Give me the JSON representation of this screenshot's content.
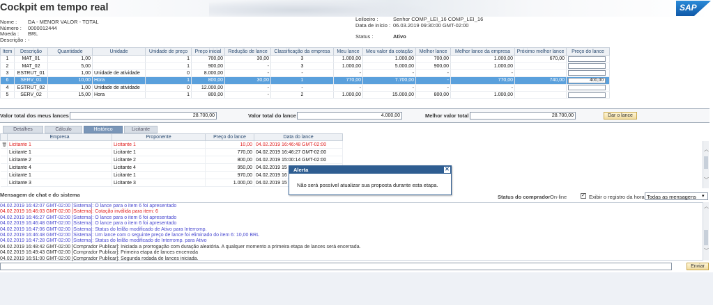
{
  "header": {
    "title": "Cockpit em tempo real",
    "sap": "SAP"
  },
  "info_left": [
    {
      "label": "Nome :",
      "value": "DA - MENOR VALOR - TOTAL"
    },
    {
      "label": "Número :",
      "value": "0000012444"
    },
    {
      "label": "Moeda :",
      "value": "BRL"
    },
    {
      "label": "Descrição :",
      "value": "-"
    }
  ],
  "info_right": [
    {
      "label": "Leiloeiro :",
      "value": "Senhor COMP_LEI_16 COMP_LEI_16"
    },
    {
      "label": "Data de início :",
      "value": "06.03.2019 09:30:00 GMT-02:00"
    },
    {
      "label": "Status :",
      "value": "Ativo"
    }
  ],
  "items_table": {
    "headers": [
      "Item",
      "Descrição",
      "Quantidade",
      "Unidade",
      "Unidade de preço",
      "Preço inicial",
      "Redução de lance",
      "Classificação da empresa",
      "Meu lance",
      "Meu valor da cotação",
      "Melhor lance",
      "Melhor lance da empresa",
      "Próximo melhor lance",
      "Preço do lance"
    ],
    "rows": [
      [
        "1",
        "MAT_01",
        "1,00",
        "",
        "1",
        "700,00",
        "30,00",
        "3",
        "1.000,00",
        "1.000,00",
        "700,00",
        "1.000,00",
        "670,00",
        ""
      ],
      [
        "2",
        "MAT_02",
        "5,00",
        "",
        "1",
        "900,00",
        "-",
        "3",
        "1.000,00",
        "5.000,00",
        "900,00",
        "1.000,00",
        "",
        ""
      ],
      [
        "3",
        "ESTRUT_01",
        "1,00",
        "Unidade de atividade",
        "0",
        "8.000,00",
        "-",
        "-",
        "-",
        "-",
        "-",
        "-",
        "",
        ""
      ],
      [
        "6",
        "SERV_01",
        "10,00",
        "Hora",
        "1",
        "800,00",
        "30,00",
        "1",
        "770,00",
        "7.700,00",
        "-",
        "770,00",
        "740,00",
        "400,00"
      ],
      [
        "4",
        "ESTRUT_02",
        "1,00",
        "Unidade de atividade",
        "0",
        "12.000,00",
        "-",
        "-",
        "-",
        "-",
        "-",
        "-",
        "",
        ""
      ],
      [
        "5",
        "SERV_02",
        "15,00",
        "Hora",
        "1",
        "800,00",
        "-",
        "2",
        "1.000,00",
        "15.000,00",
        "800,00",
        "1.000,00",
        "",
        ""
      ]
    ],
    "selected_index": 3
  },
  "totals": {
    "my_bids_label": "Valor total dos meus lances",
    "my_bids_value": "28.700,00",
    "bid_total_label": "Valor total do lance",
    "bid_total_value": "4.000,00",
    "best_total_label": "Melhor valor total",
    "best_total_value": "28.700,00",
    "bid_button": "Dar o lance"
  },
  "tabs": [
    "Detalhes",
    "Cálculo",
    "Histórico",
    "Licitante"
  ],
  "active_tab": "Histórico",
  "history": {
    "headers": [
      "Empresa",
      "Proponente",
      "Preço do lance",
      "Data do lance"
    ],
    "rows": [
      [
        "Licitante 1",
        "Licitante 1",
        "10,00",
        "04.02.2019 16:46:48 GMT-02:00"
      ],
      [
        "Licitante 1",
        "Licitante 1",
        "770,00",
        "04.02.2019 16:46:27 GMT-02:00"
      ],
      [
        "Licitante 2",
        "Licitante 2",
        "800,00",
        "04.02.2019 15:00:14 GMT-02:00"
      ],
      [
        "Licitante 4",
        "Licitante 4",
        "950,00",
        "04.02.2019 15"
      ],
      [
        "Licitante 1",
        "Licitante 1",
        "970,00",
        "04.02.2019 16"
      ],
      [
        "Licitante 3",
        "Licitante 3",
        "1.000,00",
        "04.02.2019 15"
      ]
    ]
  },
  "alert": {
    "title": "Alerta",
    "message": "Não será possível atualizar sua proposta durante esta etapa."
  },
  "chat": {
    "title": "Mensagem de chat e do sistema",
    "buyer_status_label": "Status do comprador",
    "buyer_status_value": "On-line",
    "show_time_label": "Exibir o registro da hora",
    "filter_value": "Todas as mensagens",
    "send_button": "Enviar",
    "messages": [
      {
        "text": "04.02.2019 16:42:07 GMT-02:00 [Sistema]: O lance para o item 6 foi apresentado",
        "color": "#4a4ad0"
      },
      {
        "text": "04.02.2019 16:46:03 GMT-02:00 [Sistema]: Cotação inválida para item: 6",
        "color": "#e02020"
      },
      {
        "text": "04.02.2019 16:46:27 GMT-02:00 [Sistema]: O lance para o item 6 foi apresentado",
        "color": "#4a4ad0"
      },
      {
        "text": "04.02.2019 16:46:48 GMT-02:00 [Sistema]: O lance para o item 6 foi apresentado",
        "color": "#4a4ad0"
      },
      {
        "text": "04.02.2019 16:47:06 GMT-02:00 [Sistema]: Status do leilão modificado de Ativo para Interromp.",
        "color": "#4a4ad0"
      },
      {
        "text": "04.02.2019 16:46:48 GMT-02:00 [Sistema]: Um lance com o seguinte preço de lance foi eliminado do item 6: 10,00 BRL",
        "color": "#4a4ad0"
      },
      {
        "text": "04.02.2019 16:47:28 GMT-02:00 [Sistema]: Status do leilão modificado de Interromp. para Ativo",
        "color": "#4a4ad0"
      },
      {
        "text": "04.02.2019 16:48:42 GMT-02:00 [Comprador Publicar]: Iniciada a prorrogação com duração aleatória. A qualquer momento a primeira etapa de lances será encerrada.",
        "color": "#333333"
      },
      {
        "text": "04.02.2019 16:49:43 GMT-02:00 [Comprador Publicar]: Primeira etapa de lances encerrada",
        "color": "#333333"
      },
      {
        "text": "04.02.2019 16:51:00 GMT-02:00 [Comprador Publicar]: Segunda rodada de lances iniciada.",
        "color": "#333333"
      }
    ]
  }
}
